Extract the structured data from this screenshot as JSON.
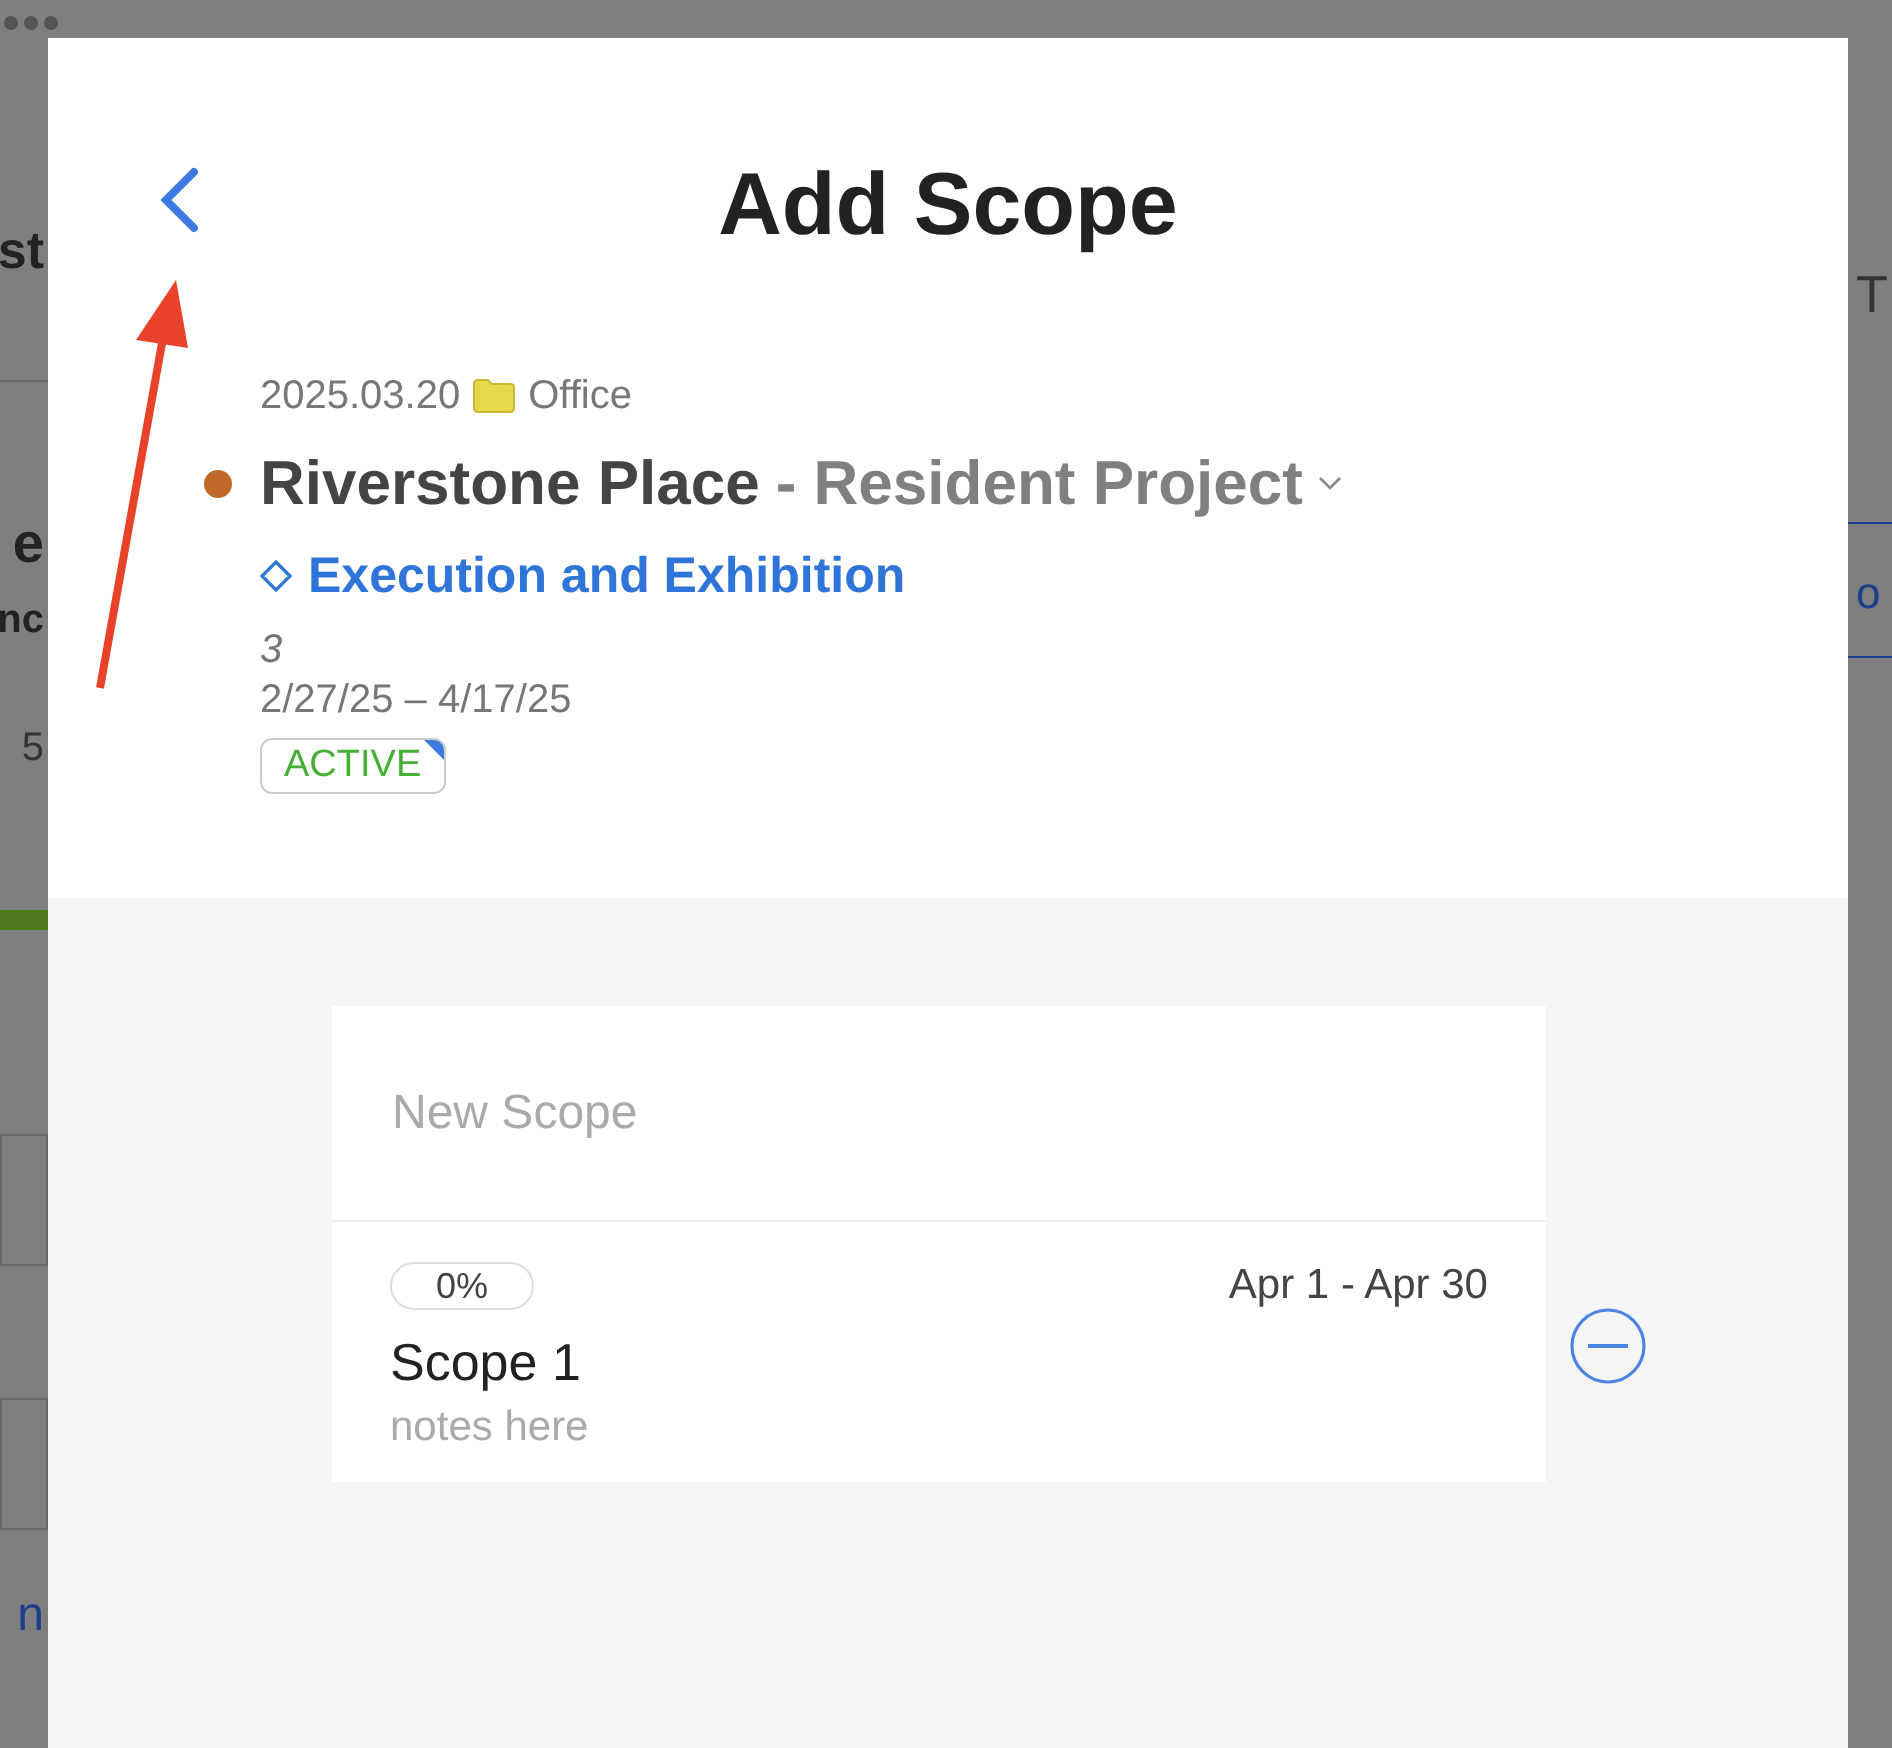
{
  "background": {
    "left_texts": [
      {
        "kind": "title",
        "text": "st"
      },
      {
        "kind": "heading",
        "text": "e"
      },
      {
        "kind": "subheading",
        "text": "nc"
      },
      {
        "kind": "meta",
        "text": "5"
      },
      {
        "kind": "link",
        "text": "n"
      }
    ],
    "progress": {
      "level": 1
    },
    "right_texts": [
      {
        "kind": "heading",
        "text": "T"
      },
      {
        "kind": "tab",
        "text": "o"
      }
    ]
  },
  "modal": {
    "title": "Add Scope",
    "project": {
      "date": "2025.03.20",
      "folder": "Office",
      "color": "#c0692a",
      "name": "Riverstone Place",
      "subtitle": "- Resident Project",
      "phase": "Execution and Exhibition",
      "count": "3",
      "dates": "2/27/25 – 4/17/25",
      "status": "ACTIVE"
    },
    "new_scope": {
      "placeholder": "New Scope"
    },
    "scopes": [
      {
        "progress": "0%",
        "dates": "Apr 1 - Apr 30",
        "name": "Scope 1",
        "notes": "notes here"
      }
    ]
  }
}
